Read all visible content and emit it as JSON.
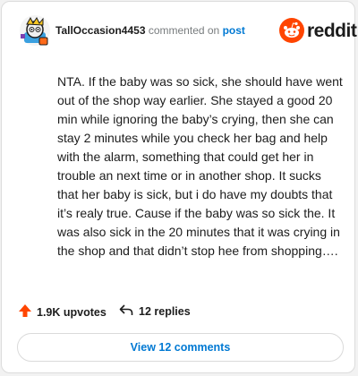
{
  "header": {
    "username": "TallOccasion4453",
    "commented_on_text": "commented on",
    "post_link": "post",
    "brand": "reddit"
  },
  "comment": {
    "body": "NTA. If the baby was so sick, she should have went out of the shop way earlier. She stayed a good 20 min while ignoring the baby’s crying, then she can stay 2 minutes while you check her bag and help with the alarm, something that could get her in trouble an next time or in another shop. It sucks that her baby is sick, but i do have my doubts that it’s realy true. Cause if the baby was so sick the. It was also sick in the 20 minutes that it was crying in the shop and that didn’t stop hee from shopping…."
  },
  "actions": {
    "upvotes": "1.9K upvotes",
    "replies": "12 replies"
  },
  "view_comments": "View 12 comments",
  "colors": {
    "upvote": "#ff4500",
    "link": "#0079d3",
    "brand": "#ff4500"
  },
  "icons": [
    "avatar",
    "reddit-logo-icon",
    "upvote-arrow-icon",
    "reply-arrow-icon"
  ]
}
